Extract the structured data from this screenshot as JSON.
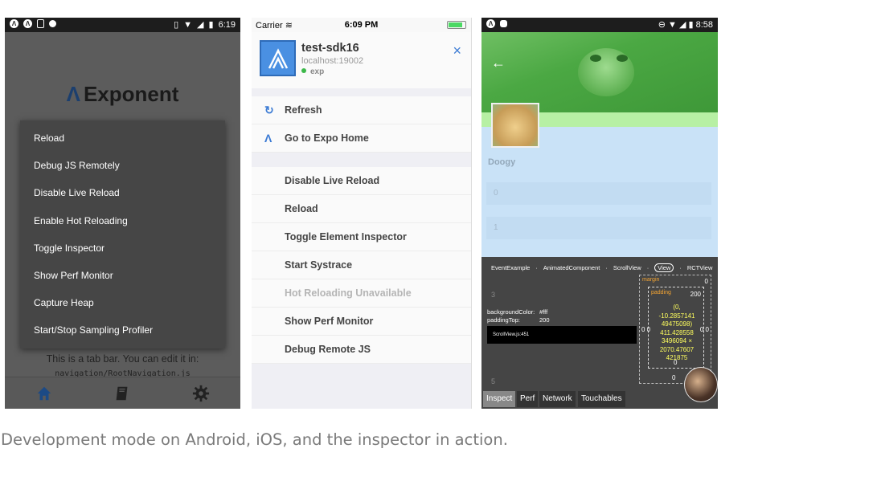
{
  "android": {
    "status_time": "6:19",
    "logo_text": "Exponent",
    "menu_items": [
      "Reload",
      "Debug JS Remotely",
      "Disable Live Reload",
      "Enable Hot Reloading",
      "Toggle Inspector",
      "Show Perf Monitor",
      "Capture Heap",
      "Start/Stop Sampling Profiler"
    ],
    "tabbar_text": "This is a tab bar. You can edit it in:",
    "tabbar_code": "navigation/RootNavigation.js",
    "tabs": [
      "home-icon",
      "book-icon",
      "gear-icon"
    ],
    "accent": "#1c3f6e"
  },
  "ios": {
    "carrier": "Carrier",
    "status_time": "6:09 PM",
    "app_name": "test-sdk16",
    "host": "localhost:19002",
    "release_channel": "exp",
    "close_glyph": "×",
    "primary_actions": [
      {
        "icon": "refresh-icon",
        "glyph": "↻",
        "label": "Refresh"
      },
      {
        "icon": "expo-logo-icon",
        "glyph": "Λ",
        "label": "Go to Expo Home"
      }
    ],
    "dev_actions": [
      {
        "label": "Disable Live Reload",
        "disabled": false
      },
      {
        "label": "Reload",
        "disabled": false
      },
      {
        "label": "Toggle Element Inspector",
        "disabled": false
      },
      {
        "label": "Start Systrace",
        "disabled": false
      },
      {
        "label": "Hot Reloading Unavailable",
        "disabled": true
      },
      {
        "label": "Show Perf Monitor",
        "disabled": false
      },
      {
        "label": "Debug Remote JS",
        "disabled": false
      }
    ],
    "accent": "#3c7bd4"
  },
  "inspector": {
    "status_time": "8:58",
    "back_glyph": "←",
    "title": "Doogy",
    "list_items": [
      "0",
      "1"
    ],
    "ghost_items": [
      "3",
      "5"
    ],
    "breadcrumbs": [
      "EventExample",
      "AnimatedComponent",
      "ScrollView",
      "View",
      "RCTView"
    ],
    "selected_crumb": "View",
    "props": [
      {
        "key": "backgroundColor:",
        "value": "#fff"
      },
      {
        "key": "paddingTop:",
        "value": "200"
      }
    ],
    "source": "ScrollView.js:451",
    "box_model": {
      "margin_label": "margin",
      "padding_label": "padding",
      "margin_top": "0",
      "padding_top": "200",
      "position": "(0, -10.2857141 49475098)",
      "size": "411.428558 3496094 × 2070.47607 421875",
      "left_values": "0 0",
      "right_values": "0 0",
      "padding_bottom": "0",
      "margin_bottom": "0"
    },
    "tabs": [
      "Inspect",
      "Perf",
      "Network",
      "Touchables"
    ],
    "active_tab": "Inspect"
  },
  "caption": "Development mode on Android, iOS, and the inspector in action."
}
